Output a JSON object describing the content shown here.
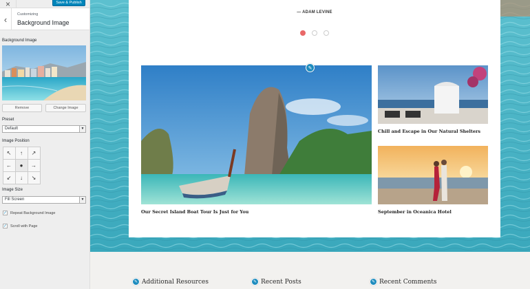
{
  "topbar": {
    "close_icon": "×",
    "save_label": "Save & Publish"
  },
  "section": {
    "back_icon": "‹",
    "breadcrumb": "Customizing",
    "title": "Background Image"
  },
  "fields": {
    "background_image_label": "Background Image",
    "remove_label": "Remove",
    "change_label": "Change Image",
    "preset_label": "Preset",
    "preset_value": "Default",
    "position_label": "Image Position",
    "position_arrows": [
      "↖",
      "↑",
      "↗",
      "←",
      "●",
      "→",
      "↙",
      "↓",
      "↘"
    ],
    "size_label": "Image Size",
    "size_value": "Fill Screen",
    "repeat_label": "Repeat Background Image",
    "scroll_label": "Scroll with Page",
    "check_mark": "✓",
    "select_arrow": "▼"
  },
  "preview": {
    "quote_author": "— ADAM LEVINE",
    "slider_dot_count": 3,
    "pen_icon": "✎",
    "posts": [
      {
        "title": "Our Secret Island Boat Tour Is Just for You"
      },
      {
        "title": "Chill and Escape in Our Natural Shelters"
      },
      {
        "title": "September in Oceanica Hotel"
      }
    ],
    "widgets": [
      "Additional Resources",
      "Recent Posts",
      "Recent Comments"
    ]
  },
  "colors": {
    "accent": "#0085ba",
    "active_dot": "#e96868",
    "edit_icon": "#1e8cbe"
  }
}
